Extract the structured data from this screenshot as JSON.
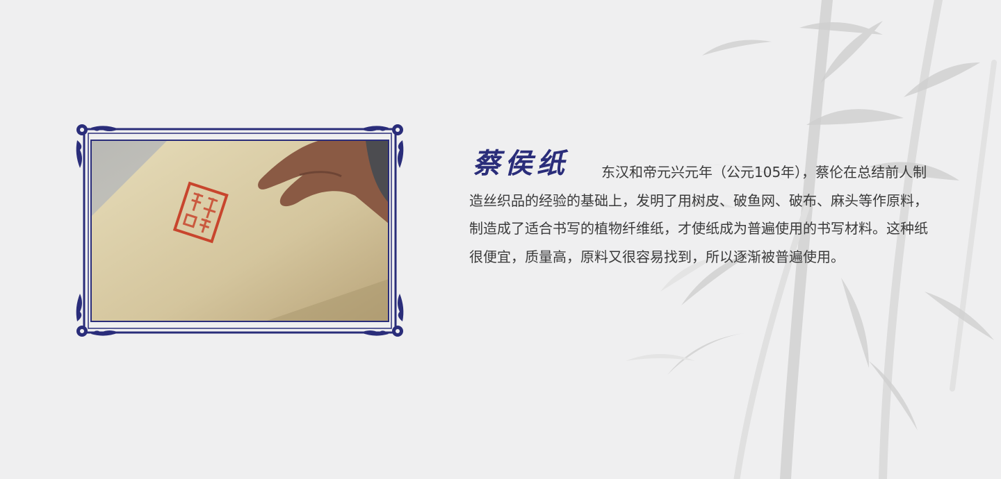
{
  "heading": "蔡侯纸",
  "paragraph": "东汉和帝元兴元年（公元105年），蔡伦在总结前人制造丝织品的经验的基础上，发明了用树皮、破鱼网、破布、麻头等作原料，制造成了适合书写的植物纤维纸，才使纸成为普遍使用的书写材料。这种纸很便宜，质量高，原料又很容易找到，所以逐渐被普遍使用。",
  "photo": {
    "subject": "hand holding aged paper with red seal",
    "seal_color": "#c8452d"
  },
  "frame": {
    "color": "#2a2d7a",
    "style": "blue-and-white porcelain ornamental border"
  },
  "background": {
    "color": "#efeff0",
    "decoration": "ink-wash bamboo"
  }
}
